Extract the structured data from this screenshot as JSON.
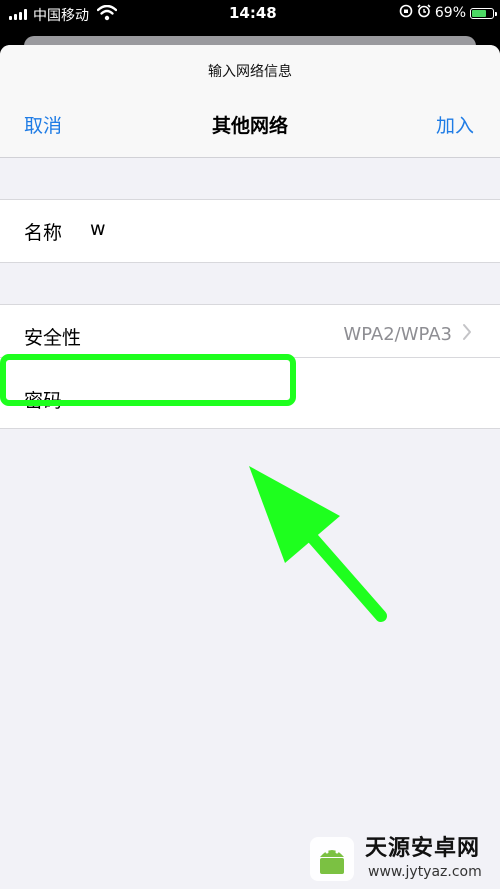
{
  "status_bar": {
    "carrier": "中国移动",
    "time": "14:48",
    "battery": "69%",
    "battery_level": 0.69,
    "icons": [
      "signal-icon",
      "wifi-icon",
      "lock-rotation-icon",
      "alarm-icon",
      "battery-charging-icon"
    ]
  },
  "sheet": {
    "prompt": "输入网络信息",
    "title": "其他网络",
    "cancel": "取消",
    "join": "加入"
  },
  "form": {
    "name_label": "名称",
    "name_value": "w",
    "security_label": "安全性",
    "security_value": "WPA2/WPA3",
    "password_label": "密码"
  },
  "annotation": {
    "highlight_color": "#1eff1e",
    "arrow_color": "#1eff1e"
  },
  "watermark": {
    "name": "天源安卓网",
    "url": "www.jytyaz.com"
  },
  "colors": {
    "accent": "#1f7ce5",
    "background": "#f2f2f7"
  }
}
